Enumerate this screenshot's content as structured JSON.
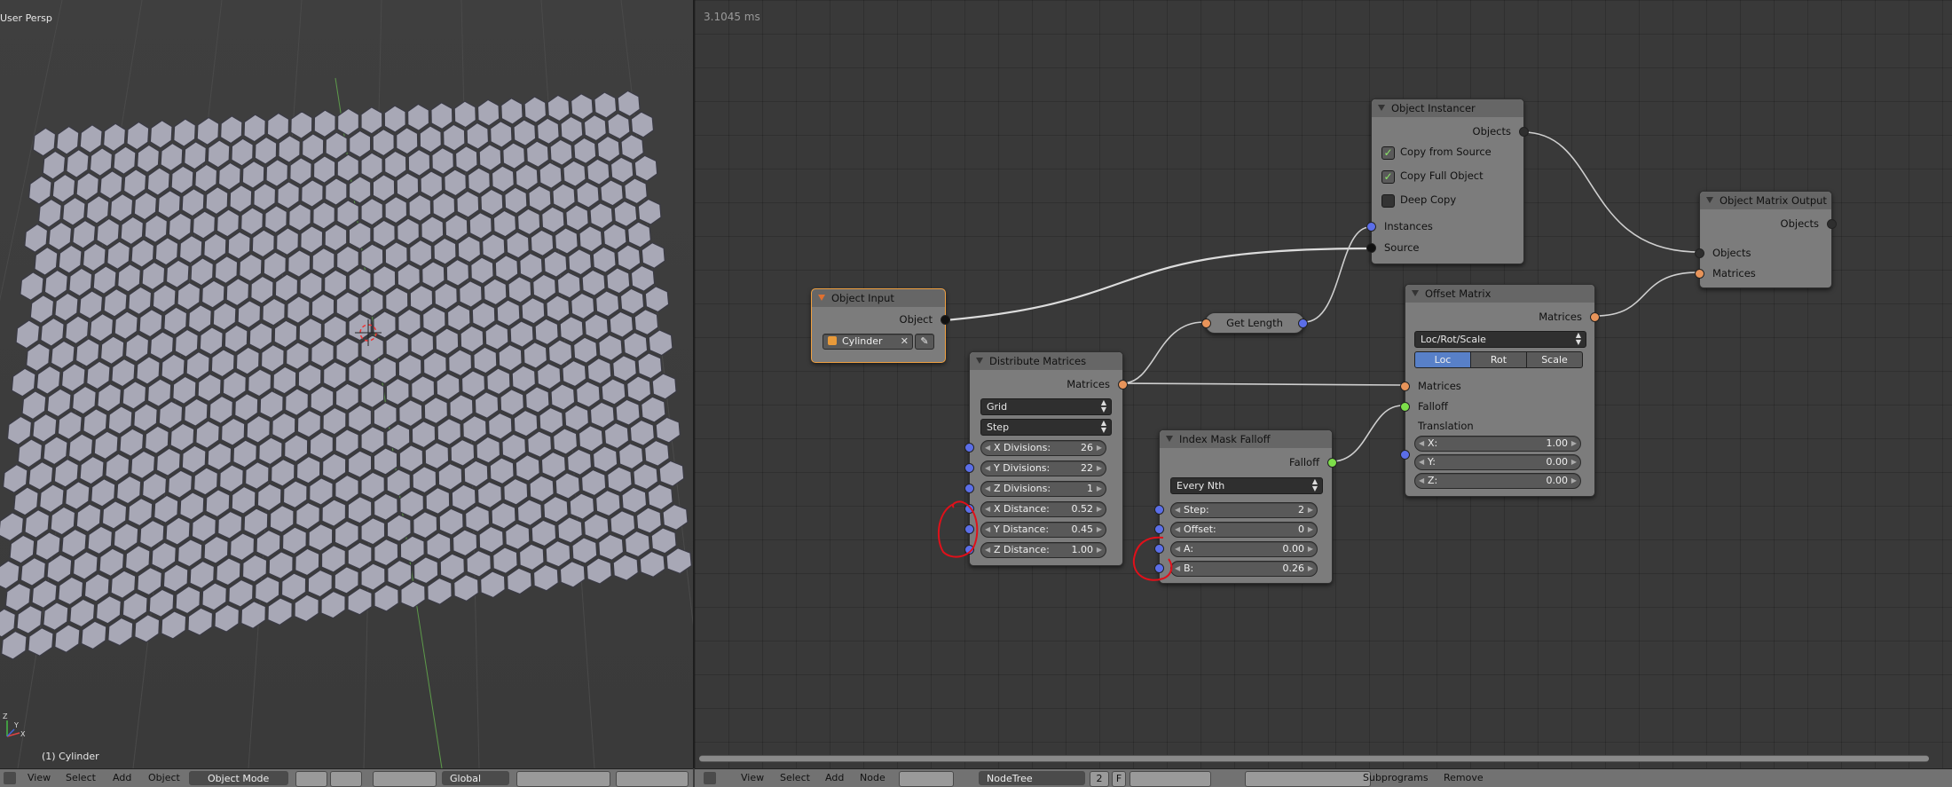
{
  "viewport": {
    "mode_label": "User Persp",
    "selected_label": "(1) Cylinder",
    "axis_labels": [
      "X",
      "Y",
      "Z"
    ]
  },
  "viewport_header": {
    "menus": [
      "View",
      "Select",
      "Add",
      "Object"
    ],
    "mode": "Object Mode",
    "orientation": "Global"
  },
  "node_editor": {
    "timing": "3.1045 ms",
    "nodes": {
      "object_input": {
        "title": "Object Input",
        "output_object": "Object",
        "object_value": "Cylinder"
      },
      "distribute_matrices": {
        "title": "Distribute Matrices",
        "output_matrices": "Matrices",
        "mode": "Grid",
        "distance_mode": "Step",
        "fields": [
          {
            "label": "X Divisions:",
            "value": "26"
          },
          {
            "label": "Y Divisions:",
            "value": "22"
          },
          {
            "label": "Z Divisions:",
            "value": "1"
          },
          {
            "label": "X Distance:",
            "value": "0.52"
          },
          {
            "label": "Y Distance:",
            "value": "0.45"
          },
          {
            "label": "Z Distance:",
            "value": "1.00"
          }
        ]
      },
      "get_length": {
        "title": "Get Length"
      },
      "index_mask_falloff": {
        "title": "Index Mask Falloff",
        "output_falloff": "Falloff",
        "mode": "Every Nth",
        "fields": [
          {
            "label": "Step:",
            "value": "2"
          },
          {
            "label": "Offset:",
            "value": "0"
          },
          {
            "label": "A:",
            "value": "0.00"
          },
          {
            "label": "B:",
            "value": "0.26"
          }
        ]
      },
      "object_instancer": {
        "title": "Object Instancer",
        "output_objects": "Objects",
        "options": [
          {
            "label": "Copy from Source",
            "checked": true
          },
          {
            "label": "Copy Full Object",
            "checked": true
          },
          {
            "label": "Deep Copy",
            "checked": false
          }
        ],
        "input_instances": "Instances",
        "input_source": "Source"
      },
      "offset_matrix": {
        "title": "Offset Matrix",
        "output_matrices": "Matrices",
        "mode": "Loc/Rot/Scale",
        "segments": [
          "Loc",
          "Rot",
          "Scale"
        ],
        "input_matrices": "Matrices",
        "input_falloff": "Falloff",
        "translation_label": "Translation",
        "fields": [
          {
            "label": "X:",
            "value": "1.00"
          },
          {
            "label": "Y:",
            "value": "0.00"
          },
          {
            "label": "Z:",
            "value": "0.00"
          }
        ]
      },
      "object_matrix_output": {
        "title": "Object Matrix Output",
        "output_objects": "Objects",
        "input_objects": "Objects",
        "input_matrices": "Matrices"
      }
    }
  },
  "node_header": {
    "menus": [
      "View",
      "Select",
      "Add",
      "Node"
    ],
    "tree_name": "NodeTree",
    "users": "2",
    "fake_user": "F",
    "actions": [
      "Subprograms",
      "Remove"
    ]
  },
  "colors": {
    "socket_object": "#111111",
    "socket_number": "#5b6ee8",
    "socket_matrix": "#e8945a",
    "socket_falloff": "#7dde4a",
    "annotation": "#e0101a"
  }
}
